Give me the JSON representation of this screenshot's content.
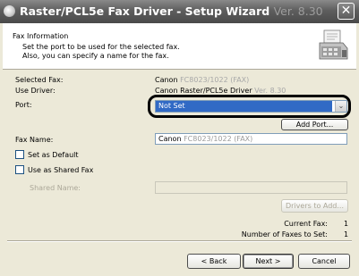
{
  "window": {
    "title": "Raster/PCL5e Fax Driver - Setup Wizard",
    "title_version": "Ver. 8.30",
    "close_glyph": "✕"
  },
  "header": {
    "title": "Fax Information",
    "description_line1": "Set the port to be used for the selected fax.",
    "description_line2": "Also, you can specify a name for the fax."
  },
  "info": {
    "selected_fax_label": "Selected Fax:",
    "selected_fax_value": "Canon",
    "selected_fax_model": "FC8023/1022 (FAX)",
    "use_driver_label": "Use Driver:",
    "use_driver_value": "Canon Raster/PCL5e Driver",
    "use_driver_version": "Ver. 8.30",
    "port_label": "Port:"
  },
  "port": {
    "selected": "Not Set",
    "arrow_glyph": "⌄"
  },
  "add_port_button": "Add Port...",
  "fax_name": {
    "label": "Fax Name:",
    "value_prefix": "Canon",
    "value_model": "FC8023/1022 (FAX)"
  },
  "options": {
    "set_default": "Set as Default",
    "use_shared": "Use as Shared Fax"
  },
  "shared": {
    "label": "Shared Name:",
    "drivers_button": "Drivers to Add..."
  },
  "counts": {
    "current_label": "Current Fax:",
    "current_value": "1",
    "total_label": "Number of Faxes to Set:",
    "total_value": "1"
  },
  "footer": {
    "back": "< Back",
    "next": "Next >",
    "cancel": "Cancel"
  }
}
